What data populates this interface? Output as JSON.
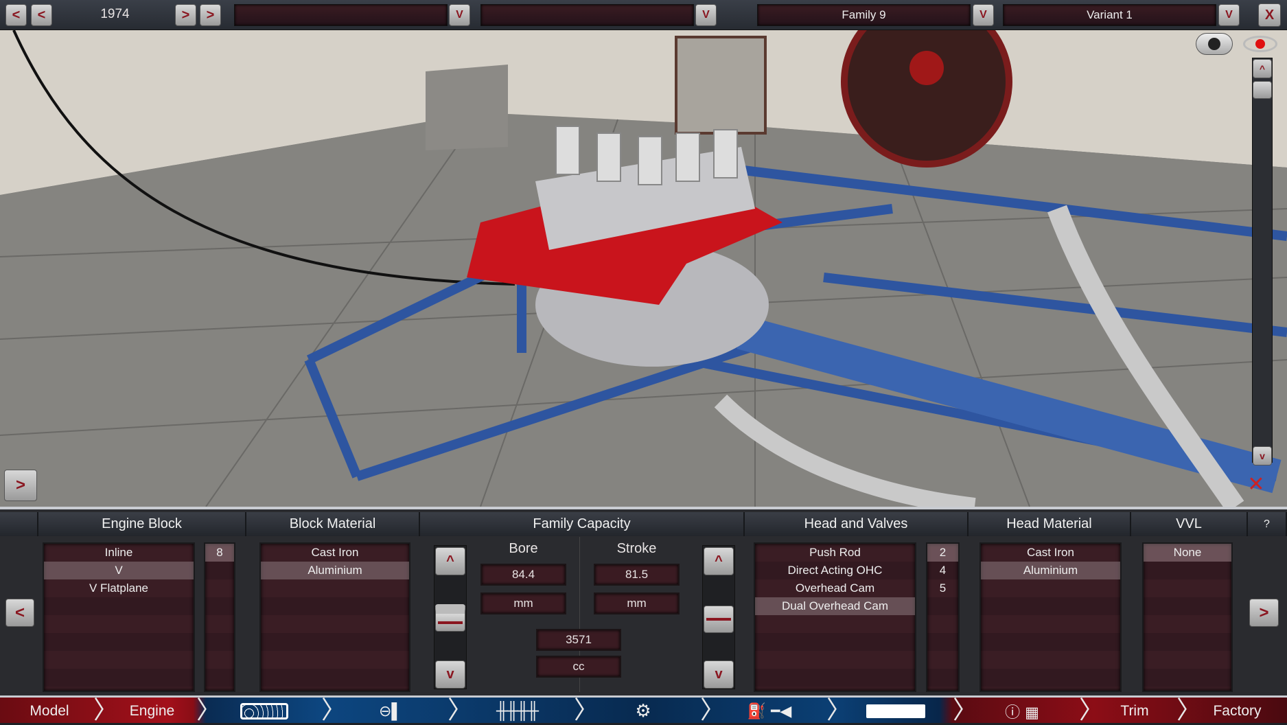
{
  "topbar": {
    "year": "1974",
    "prev_label": "<",
    "prev_fast_label": "<",
    "next_label": ">",
    "next_fast_label": ">",
    "dropdown1": "",
    "dropdown2": "",
    "family": "Family 9",
    "variant": "Variant 1",
    "dropdown_arrow": "V",
    "close_label": "X"
  },
  "viewport": {
    "expand_label": ">",
    "scroll_up": "^",
    "scroll_down": "v",
    "icons": [
      "camera-icon",
      "eye-icon",
      "rotate-icon"
    ]
  },
  "panel": {
    "left_arrow": "<",
    "right_arrow": ">",
    "help_label": "?",
    "engine_block": {
      "title": "Engine Block",
      "options": [
        "Inline",
        "V",
        "V Flatplane"
      ],
      "selected": "V",
      "cylinders": [
        "8"
      ]
    },
    "block_material": {
      "title": "Block Material",
      "options": [
        "Cast Iron",
        "Aluminium"
      ],
      "selected": "Aluminium"
    },
    "family_capacity": {
      "title": "Family Capacity",
      "bore_label": "Bore",
      "bore_value": "84.4",
      "bore_unit": "mm",
      "stroke_label": "Stroke",
      "stroke_value": "81.5",
      "stroke_unit": "mm",
      "capacity_value": "3571",
      "capacity_unit": "cc",
      "up": "^",
      "down": "v"
    },
    "head_and_valves": {
      "title": "Head and Valves",
      "options": [
        "Push Rod",
        "Direct Acting OHC",
        "Overhead Cam",
        "Dual Overhead Cam"
      ],
      "selected": "Dual Overhead Cam",
      "valves": [
        "2",
        "4",
        "5"
      ],
      "selected_valves": "2"
    },
    "head_material": {
      "title": "Head Material",
      "options": [
        "Cast Iron",
        "Aluminium"
      ],
      "selected": "Aluminium"
    },
    "vvl": {
      "title": "VVL",
      "options": [
        "None"
      ],
      "selected": "None"
    }
  },
  "nav": {
    "model": "Model",
    "engine": "Engine",
    "trim": "Trim",
    "factory": "Factory",
    "icons": [
      "engine-block-icon",
      "piston-icon",
      "valvetrain-icon",
      "turbo-icon",
      "fuel-icon",
      "exhaust-icon",
      "dyno-icon"
    ]
  },
  "colors": {
    "accent_red": "#8a1620",
    "nav_blue": "#0d4680",
    "list_bg": "#3a1d24"
  }
}
